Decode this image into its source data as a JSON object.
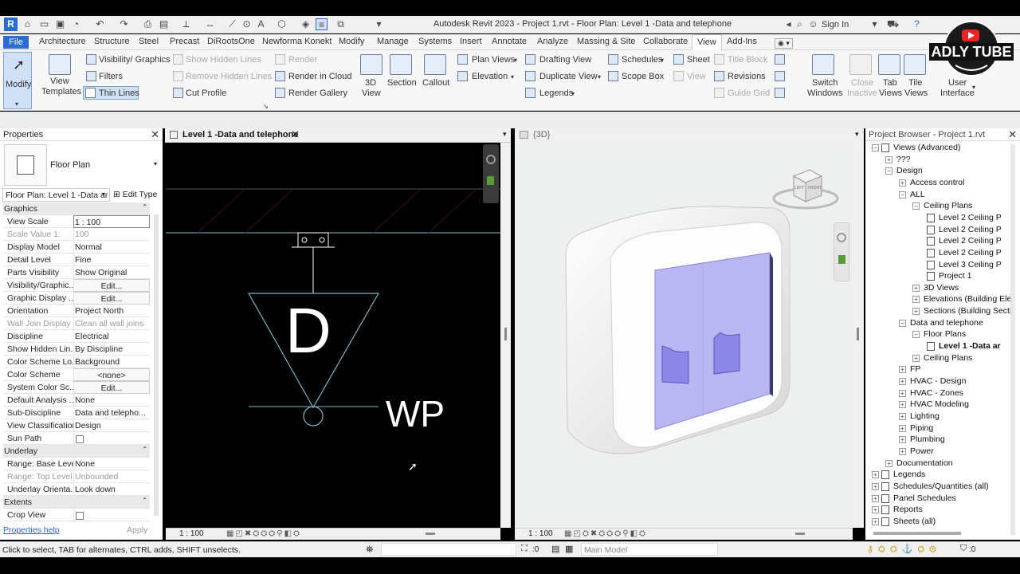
{
  "app": {
    "title": "Autodesk Revit 2023 - Project 1.rvt - Floor Plan: Level 1 -Data and telephone",
    "sign_in": "Sign In"
  },
  "watermark": {
    "brand": "ADLY TUBE"
  },
  "ribbon_tabs": [
    "File",
    "Architecture",
    "Structure",
    "Steel",
    "Precast",
    "DiRootsOne",
    "Newforma Konekt",
    "Modify",
    "Manage",
    "Systems",
    "Insert",
    "Annotate",
    "Analyze",
    "Massing & Site",
    "Collaborate",
    "View",
    "Add-Ins"
  ],
  "ribbon": {
    "modify": "Modify",
    "view_templates_1": "View",
    "view_templates_2": "Templates",
    "visibility_graphics": "Visibility/ Graphics",
    "filters": "Filters",
    "thin_lines": "Thin Lines",
    "show_hidden_lines": "Show  Hidden Lines",
    "remove_hidden_lines": "Remove  Hidden Lines",
    "cut_profile": "Cut  Profile",
    "render": "Render",
    "render_in_cloud": "Render  in Cloud",
    "render_gallery": "Render  Gallery",
    "view_3d_1": "3D",
    "view_3d_2": "View",
    "section": "Section",
    "callout": "Callout",
    "plan_views": "Plan  Views",
    "elevation": "Elevation",
    "drafting_view": "Drafting  View",
    "duplicate_view": "Duplicate  View",
    "legends": "Legends",
    "schedules": "Schedules",
    "scope_box": "Scope  Box",
    "sheet": "Sheet",
    "view": "View",
    "title_block": "Title  Block",
    "revisions": "Revisions",
    "guide_grid": "Guide  Grid",
    "switch_windows_1": "Switch",
    "switch_windows_2": "Windows",
    "close_inactive_1": "Close",
    "close_inactive_2": "Inactive",
    "tab_views_1": "Tab",
    "tab_views_2": "Views",
    "tile_views_1": "Tile",
    "tile_views_2": "Views",
    "user_interface_1": "User",
    "user_interface_2": "Interface"
  },
  "properties": {
    "title": "Properties",
    "type_name": "Floor Plan",
    "instance_selector": "Floor Plan: Level 1 -Data ar",
    "edit_type": "Edit Type",
    "help_link": "Properties help",
    "apply": "Apply",
    "rows": [
      {
        "k": "Graphics",
        "v": "",
        "sec": true
      },
      {
        "k": "View Scale",
        "v": "1 : 100",
        "box": true
      },
      {
        "k": "Scale Value    1:",
        "v": "100",
        "grey": true
      },
      {
        "k": "Display Model",
        "v": "Normal"
      },
      {
        "k": "Detail Level",
        "v": "Fine"
      },
      {
        "k": "Parts Visibility",
        "v": "Show Original"
      },
      {
        "k": "Visibility/Graphic...",
        "v": "Edit...",
        "btn": true
      },
      {
        "k": "Graphic Display ...",
        "v": "Edit...",
        "btn": true
      },
      {
        "k": "Orientation",
        "v": "Project North"
      },
      {
        "k": "Wall Join Display",
        "v": "Clean all wall joins",
        "grey": true
      },
      {
        "k": "Discipline",
        "v": "Electrical"
      },
      {
        "k": "Show Hidden Lin...",
        "v": "By Discipline"
      },
      {
        "k": "Color Scheme Lo...",
        "v": "Background"
      },
      {
        "k": "Color Scheme",
        "v": "<none>",
        "btn": true
      },
      {
        "k": "System Color Sc...",
        "v": "Edit...",
        "btn": true
      },
      {
        "k": "Default Analysis ...",
        "v": "None"
      },
      {
        "k": "Sub-Discipline",
        "v": "Data and telepho..."
      },
      {
        "k": "View Classification",
        "v": "Design"
      },
      {
        "k": "Sun Path",
        "v": "",
        "check": true
      },
      {
        "k": "Underlay",
        "v": "",
        "sec": true
      },
      {
        "k": "Range: Base Level",
        "v": "None"
      },
      {
        "k": "Range: Top Level",
        "v": "Unbounded",
        "grey": true
      },
      {
        "k": "Underlay Orienta...",
        "v": "Look down"
      },
      {
        "k": "Extents",
        "v": "",
        "sec": true
      },
      {
        "k": "Crop View",
        "v": "",
        "check": true
      }
    ]
  },
  "view1": {
    "tab_label": "Level 1 -Data and telephone",
    "symbol_letter": "D",
    "tag_text": "WP",
    "scale": "1 : 100"
  },
  "view2": {
    "tab_label": "{3D}",
    "scale": "1 : 100",
    "viewcube_left": "LEFT",
    "viewcube_front": "FRONT"
  },
  "browser": {
    "title": "Project Browser - Project 1.rvt",
    "nodes": [
      {
        "t": "Views (Advanced)",
        "lvl": 0,
        "exp": "-",
        "ico": "views"
      },
      {
        "t": "???",
        "lvl": 1,
        "exp": "+"
      },
      {
        "t": "Design",
        "lvl": 1,
        "exp": "-"
      },
      {
        "t": "Access control",
        "lvl": 2,
        "exp": "+"
      },
      {
        "t": "ALL",
        "lvl": 2,
        "exp": "-"
      },
      {
        "t": "Ceiling Plans",
        "lvl": 3,
        "exp": "-"
      },
      {
        "t": "Level 2 Ceiling P",
        "lvl": 4,
        "sheet": true
      },
      {
        "t": "Level 2 Ceiling P",
        "lvl": 4,
        "sheet": true
      },
      {
        "t": "Level 2 Ceiling P",
        "lvl": 4,
        "sheet": true
      },
      {
        "t": "Level 2 Ceiling P",
        "lvl": 4,
        "sheet": true
      },
      {
        "t": "Level 3 Ceiling P",
        "lvl": 4,
        "sheet": true
      },
      {
        "t": "Project 1",
        "lvl": 4,
        "sheet": true
      },
      {
        "t": "3D Views",
        "lvl": 3,
        "exp": "+"
      },
      {
        "t": "Elevations (Building Ele",
        "lvl": 3,
        "exp": "+"
      },
      {
        "t": "Sections (Building Secti",
        "lvl": 3,
        "exp": "+"
      },
      {
        "t": "Data and telephone",
        "lvl": 2,
        "exp": "-"
      },
      {
        "t": "Floor Plans",
        "lvl": 3,
        "exp": "-"
      },
      {
        "t": "Level 1 -Data ar",
        "lvl": 4,
        "sheet": true,
        "bold": true
      },
      {
        "t": "Ceiling Plans",
        "lvl": 3,
        "exp": "+"
      },
      {
        "t": "FP",
        "lvl": 2,
        "exp": "+"
      },
      {
        "t": "HVAC - Design",
        "lvl": 2,
        "exp": "+"
      },
      {
        "t": "HVAC - Zones",
        "lvl": 2,
        "exp": "+"
      },
      {
        "t": "HVAC Modeling",
        "lvl": 2,
        "exp": "+"
      },
      {
        "t": "Lighting",
        "lvl": 2,
        "exp": "+"
      },
      {
        "t": "Piping",
        "lvl": 2,
        "exp": "+"
      },
      {
        "t": "Plumbing",
        "lvl": 2,
        "exp": "+"
      },
      {
        "t": "Power",
        "lvl": 2,
        "exp": "+"
      },
      {
        "t": "Documentation",
        "lvl": 1,
        "exp": "+"
      },
      {
        "t": "Legends",
        "lvl": 0,
        "exp": "+",
        "ico": "legend"
      },
      {
        "t": "Schedules/Quantities (all)",
        "lvl": 0,
        "exp": "+",
        "ico": "sched"
      },
      {
        "t": "Panel Schedules",
        "lvl": 0,
        "exp": "+",
        "ico": "sched"
      },
      {
        "t": "Reports",
        "lvl": 0,
        "exp": "+",
        "ico": "sched"
      },
      {
        "t": "Sheets (all)",
        "lvl": 0,
        "exp": "+",
        "ico": "sched"
      }
    ]
  },
  "status": {
    "text": "Click to select, TAB for alternates, CTRL adds, SHIFT unselects.",
    "count_left": ":0",
    "model": "Main Model",
    "count_right": ":0"
  },
  "colors": {
    "accent": "#2b6cd3",
    "plan_line": "#7fb5c4",
    "glass": "#b9b6f2"
  }
}
